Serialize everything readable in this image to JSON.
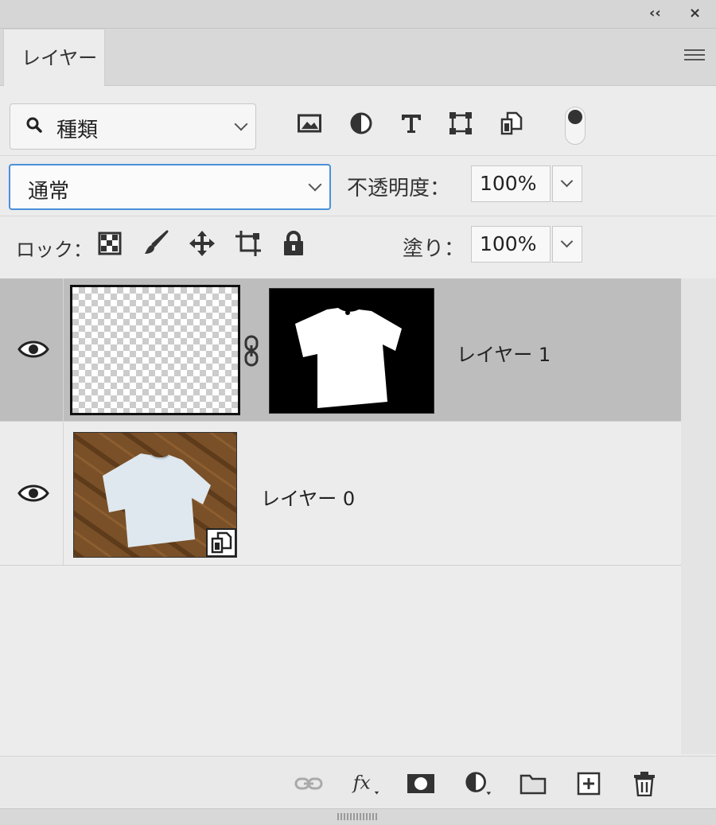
{
  "panel": {
    "tab_label": "レイヤー"
  },
  "window_controls": {
    "collapse": "‹‹",
    "close": "×"
  },
  "filter": {
    "kind_label": "種類",
    "icons": [
      "image-filter-icon",
      "adjustment-filter-icon",
      "type-filter-icon",
      "shape-filter-icon",
      "smart-object-filter-icon"
    ],
    "toggle_on": true
  },
  "blend": {
    "mode": "通常",
    "opacity_label": "不透明度：",
    "opacity_value": "100%"
  },
  "lock": {
    "label": "ロック：",
    "fill_label": "塗り：",
    "fill_value": "100%",
    "icons": [
      "lock-transparent-pixels-icon",
      "lock-image-pixels-icon",
      "lock-position-icon",
      "lock-artboard-icon",
      "lock-all-icon"
    ]
  },
  "layers": [
    {
      "name": "レイヤー 1",
      "visible": true,
      "selected": true,
      "has_mask": true,
      "transparent": true
    },
    {
      "name": "レイヤー 0",
      "visible": true,
      "selected": false,
      "smart_object": true
    }
  ],
  "bottom_tools": [
    "link-layers-icon",
    "fx-icon",
    "add-mask-icon",
    "adjustment-layer-icon",
    "new-group-icon",
    "new-layer-icon",
    "delete-layer-icon"
  ],
  "colors": {
    "accent": "#4a90d9",
    "selected_layer": "#bdbdbd"
  }
}
